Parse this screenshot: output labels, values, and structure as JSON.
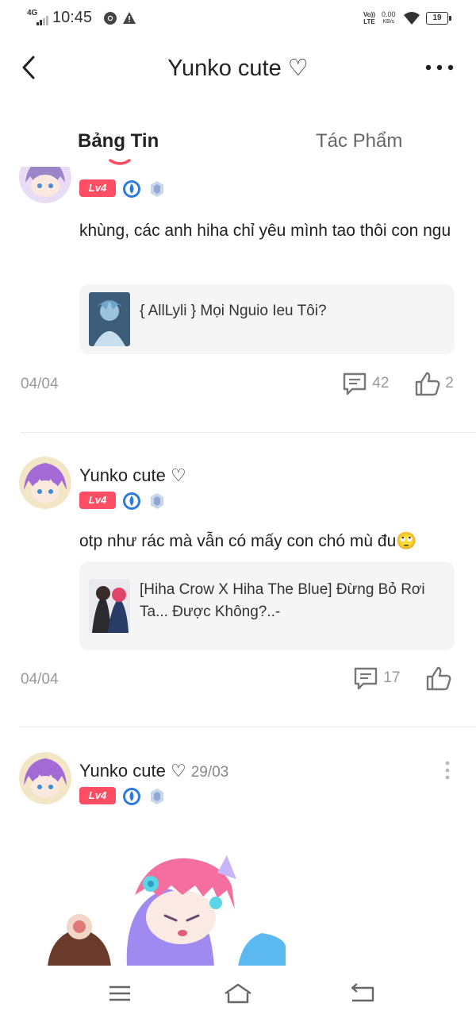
{
  "status_bar": {
    "network": "4G",
    "time": "10:45",
    "volte_top": "Vo))",
    "volte_bottom": "LTE",
    "speed_value": "0.00",
    "speed_unit": "KB/s",
    "battery": "19"
  },
  "header": {
    "title": "Yunko cute ♡"
  },
  "tabs": [
    {
      "label": "Bảng Tin",
      "active": true
    },
    {
      "label": "Tác Phẩm",
      "active": false
    }
  ],
  "accent_color": "#ff4d63",
  "posts": [
    {
      "level": "Lv4",
      "text": "khùng, các anh hiha chỉ yêu mình tao thôi con ngu",
      "linked_story": "{ AllLyli } Mọi Nguio Ieu Tôi?",
      "date": "04/04",
      "comments": "42",
      "likes": "2"
    },
    {
      "author": "Yunko cute ♡",
      "level": "Lv4",
      "text": "otp như rác mà vẫn có mấy con chó mù đu🙄",
      "linked_story": "[Hiha Crow X Hiha The Blue] Đừng Bỏ Rơi Ta... Được Không?..-",
      "date": "04/04",
      "comments": "17"
    },
    {
      "author": "Yunko cute ♡",
      "date": "29/03",
      "level": "Lv4"
    }
  ]
}
